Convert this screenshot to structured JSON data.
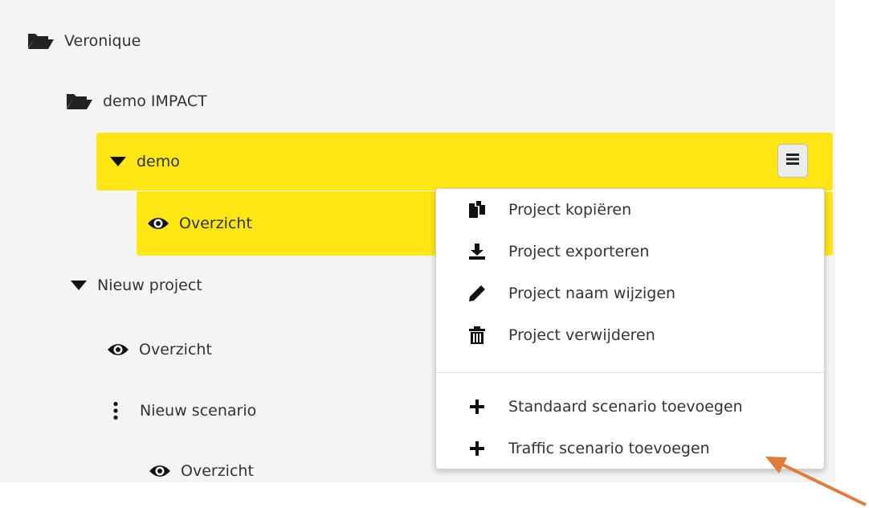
{
  "tree": {
    "root": {
      "label": "Veronique",
      "icon": "folder-open-icon"
    },
    "folder": {
      "label": "demo IMPACT",
      "icon": "folder-open-icon"
    },
    "project_demo": {
      "label": "demo",
      "icon": "caret-down-icon",
      "menu_icon": "hamburger-menu-icon"
    },
    "demo_overview": {
      "label": "Overzicht",
      "icon": "eye-icon"
    },
    "project_new": {
      "label": "Nieuw project",
      "icon": "caret-down-icon"
    },
    "new_overview": {
      "label": "Overzicht",
      "icon": "eye-icon"
    },
    "scenario": {
      "label": "Nieuw scenario",
      "icon": "vertical-dots-icon"
    },
    "scenario_overview": {
      "label": "Overzicht",
      "icon": "eye-icon"
    }
  },
  "menu": {
    "items": [
      {
        "label": "Project kopiëren",
        "icon": "copy-icon"
      },
      {
        "label": "Project exporteren",
        "icon": "download-icon"
      },
      {
        "label": "Project naam wijzigen",
        "icon": "pencil-icon"
      },
      {
        "label": "Project verwijderen",
        "icon": "trash-icon"
      },
      {
        "label": "Standaard scenario toevoegen",
        "icon": "plus-icon"
      },
      {
        "label": "Traffic scenario toevoegen",
        "icon": "plus-icon"
      }
    ]
  },
  "colors": {
    "highlight": "#ffe615",
    "tree_bg": "#f4f4f4",
    "annotation_arrow": "#e07b39",
    "text": "#333333"
  }
}
